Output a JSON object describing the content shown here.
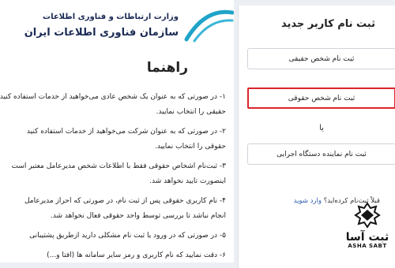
{
  "org": {
    "line1": "وزارت ارتباطات و فناوری اطلاعات",
    "line2": "سازمان فناوری اطلاعات ایران"
  },
  "guide": {
    "title": "راهنما",
    "items": [
      "۱- در صورتی که به عنوان یک شخص عادی می‌خواهید از خدمات استفاده کنید",
      "حقیقی را انتخاب نمایید.",
      "۲- در صورتی که به عنوان شرکت می‌خواهید از خدمات استفاده کنید",
      "حقوقی را انتخاب نمایید.",
      "۳- ثبت‌نام اشخاص حقوقی فقط با اطلاعات شخص مدیرعامل معتبر است",
      "اینصورت تایید نخواهد شد.",
      "۴- نام کاربری حقوقی پس از ثبت نام، در صورتی که احراز مدیرعامل",
      "انجام نباشد تا بررسی توسط واحد حقوقی فعال نخواهد شد.",
      "۵- در صورتی که در ورود یا ثبت نام مشکلی دارید ازطریق پشتیبانی",
      "۶- دقت نمایید که نام کاربری و رمز سایر سامانه ها (افتا و...)"
    ]
  },
  "register": {
    "title": "ثبت نام کاربر جدید",
    "btn_natural": "ثبت نام شخص حقیقی",
    "btn_legal": "ثبت نام شخص حقوقی",
    "or": "یا",
    "btn_device": "ثبت نام نماینده دستگاه اجرایی",
    "login_prompt": "قبلاً ثبت‌نام کرده‌اید؟",
    "login_link": "وارد شوید"
  },
  "watermark": {
    "fa": "ثبت آسا",
    "en": "ASHA SABT"
  },
  "colors": {
    "highlight": "#d9262c",
    "org_text": "#1b2a55",
    "link": "#2a5db0"
  }
}
